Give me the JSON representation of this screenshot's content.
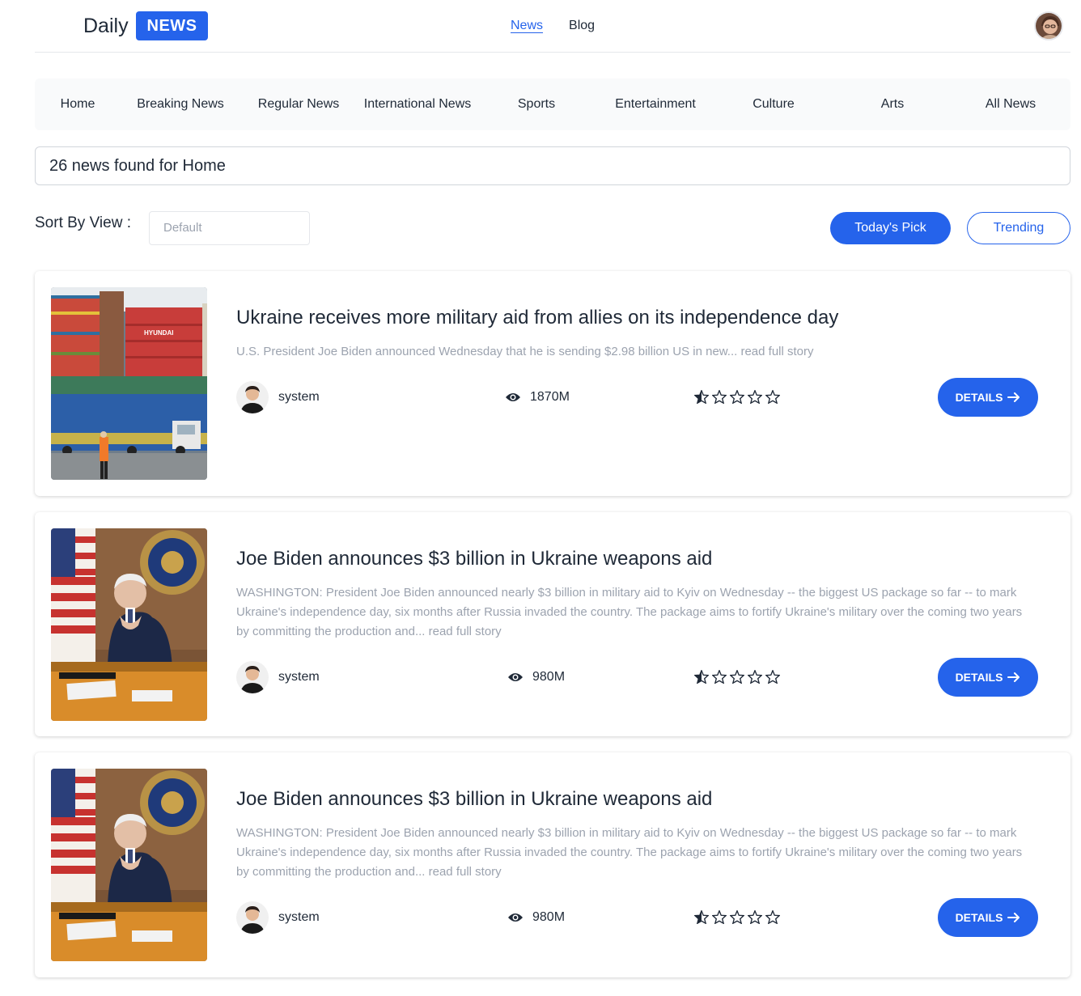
{
  "brand": {
    "word": "Daily",
    "badge": "NEWS",
    "accent": "#2563eb"
  },
  "topnav": [
    {
      "label": "News",
      "active": true
    },
    {
      "label": "Blog",
      "active": false
    }
  ],
  "categories": [
    "Home",
    "Breaking News",
    "Regular News",
    "International News",
    "Sports",
    "Entertainment",
    "Culture",
    "Arts",
    "All News"
  ],
  "found_text": "26 news found for Home",
  "sort": {
    "label": "Sort By View :",
    "placeholder": "Default"
  },
  "buttons": {
    "todays_pick": "Today's Pick",
    "trending": "Trending"
  },
  "news": [
    {
      "title": "Ukraine receives more military aid from allies on its independence day",
      "excerpt": "U.S. President Joe Biden announced Wednesday that he is sending $2.98 billion US in new... read full story",
      "author": "system",
      "views": "1870M",
      "rating": 0.5,
      "details_label": "DETAILS",
      "image": "shipping-containers-photo"
    },
    {
      "title": "Joe Biden announces $3 billion in Ukraine weapons aid",
      "excerpt": "WASHINGTON: President Joe Biden announced nearly $3 billion in military aid to Kyiv on Wednesday -- the biggest US package so far -- to mark Ukraine's independence day, six months after Russia invaded the country. The package aims to fortify Ukraine's military over the coming two years by committing the production and... read full story",
      "author": "system",
      "views": "980M",
      "rating": 0.5,
      "details_label": "DETAILS",
      "image": "biden-at-desk-photo"
    },
    {
      "title": "Joe Biden announces $3 billion in Ukraine weapons aid",
      "excerpt": "WASHINGTON: President Joe Biden announced nearly $3 billion in military aid to Kyiv on Wednesday -- the biggest US package so far -- to mark Ukraine's independence day, six months after Russia invaded the country. The package aims to fortify Ukraine's military over the coming two years by committing the production and... read full story",
      "author": "system",
      "views": "980M",
      "rating": 0.5,
      "details_label": "DETAILS",
      "image": "biden-at-desk-photo"
    }
  ]
}
